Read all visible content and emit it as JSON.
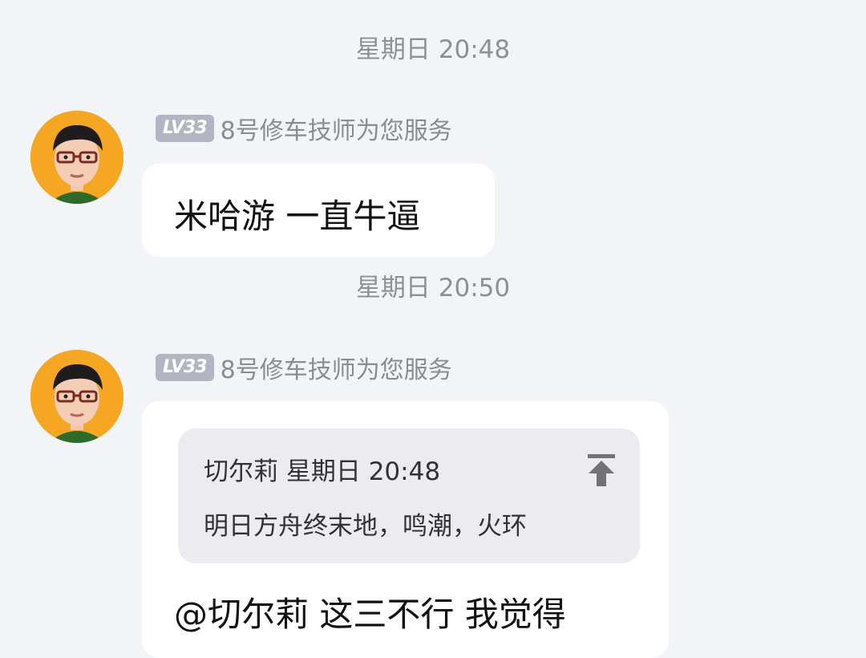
{
  "messages": [
    {
      "timestamp": "星期日 20:48",
      "level": "LV33",
      "nickname": "8号修车技师为您服务",
      "text": "米哈游  一直牛逼"
    },
    {
      "timestamp": "星期日 20:50",
      "level": "LV33",
      "nickname": "8号修车技师为您服务",
      "quote": {
        "author": "切尔莉",
        "time": "星期日 20:48",
        "text": "明日方舟终末地，鸣潮，火环"
      },
      "text": "@切尔莉 这三不行   我觉得"
    }
  ],
  "icons": {
    "avatar": "cartoon-avatar-icon",
    "quote_pin": "jump-to-top-icon"
  },
  "colors": {
    "background": "#f3f4f8",
    "bubble": "#ffffff",
    "quote_bg": "#ececf0",
    "badge": "#b3b6c2",
    "avatar_bg": "#f5a623"
  }
}
